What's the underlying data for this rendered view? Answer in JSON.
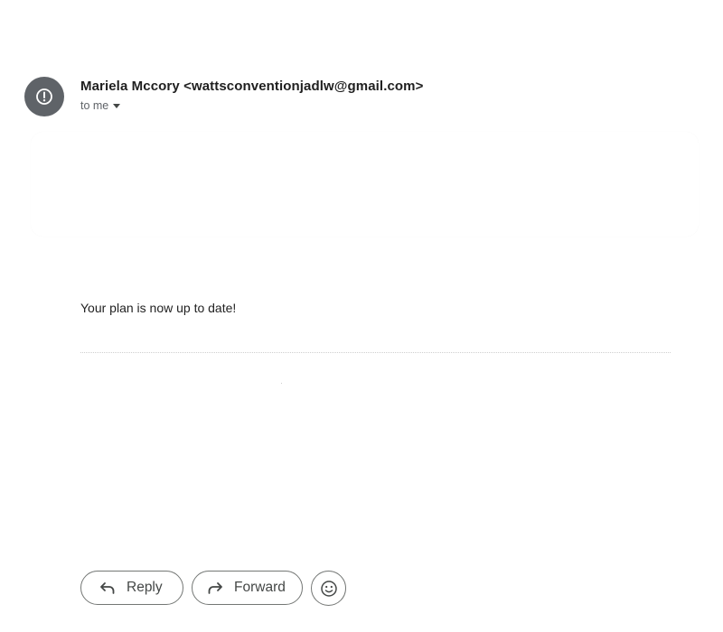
{
  "message": {
    "sender_name": "Mariela Mccory",
    "sender_email": "<wattsconventionjadlw@gmail.com>",
    "recipient_label": "to me",
    "body": "Your plan is now up to date!"
  },
  "actions": {
    "reply_label": "Reply",
    "forward_label": "Forward"
  },
  "icons": {
    "avatar": "alert-circle-icon",
    "recipient_toggle": "caret-down-icon",
    "reply": "reply-icon",
    "forward": "forward-icon",
    "reaction": "emoji-icon"
  },
  "colors": {
    "avatar_background": "#5f6368",
    "button_border": "#747775",
    "text_primary": "#1f1f1f",
    "text_secondary": "#5f6368"
  }
}
